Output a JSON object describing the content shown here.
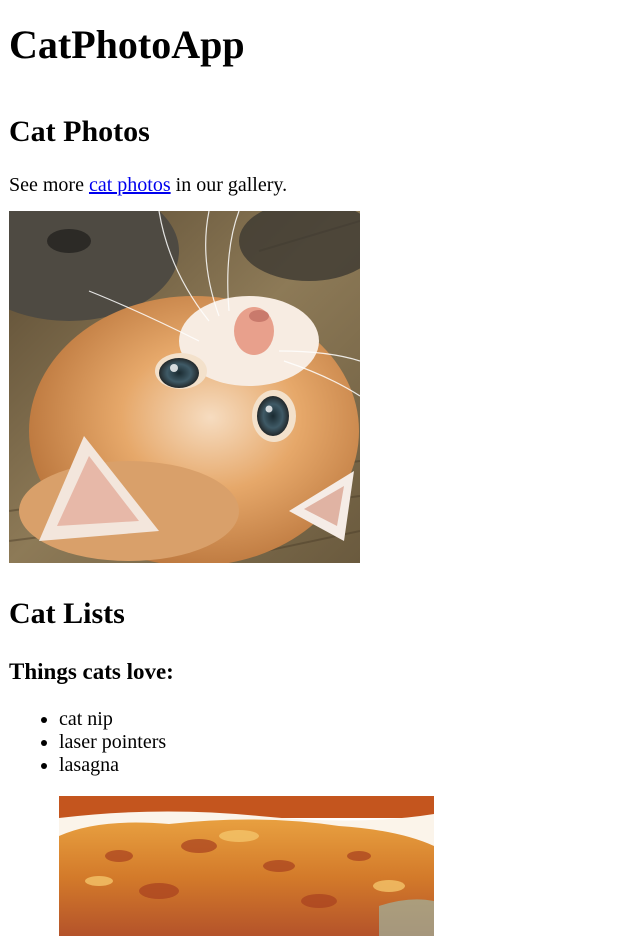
{
  "header": {
    "title": "CatPhotoApp"
  },
  "photos_section": {
    "heading": "Cat Photos",
    "text_before": "See more ",
    "link_text": "cat photos",
    "text_after": " in our gallery."
  },
  "lists_section": {
    "heading": "Cat Lists",
    "subheading": "Things cats love:",
    "items": [
      "cat nip",
      "laser pointers",
      "lasagna"
    ]
  },
  "images": {
    "cat_image_icon": "kitten-photo",
    "lasagna_image_icon": "lasagna-photo"
  },
  "colors": {
    "link": "#0000ee",
    "text": "#000000",
    "background": "#ffffff"
  }
}
